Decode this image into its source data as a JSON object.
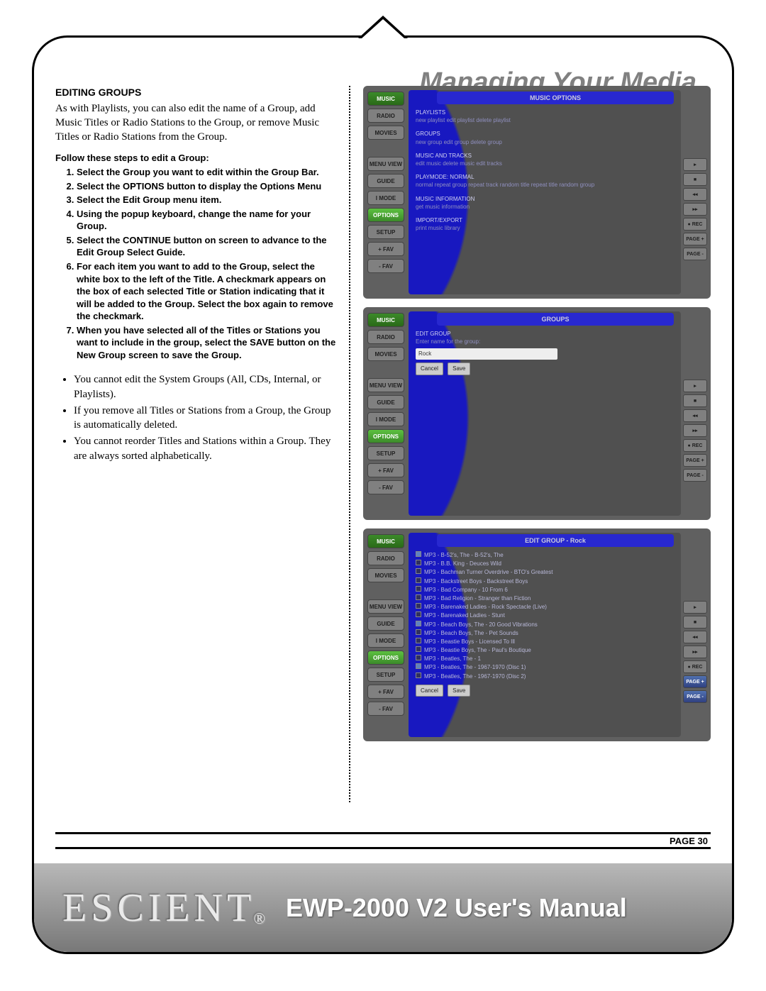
{
  "header": {
    "title": "Managing Your Media"
  },
  "section": {
    "heading": "EDITING GROUPS",
    "intro": "As with Playlists, you can also edit the name of a Group, add Music Titles or Radio Stations to the Group, or remove Music Titles or Radio Stations from the Group.",
    "steps_title": "Follow these steps to edit a Group:",
    "steps": [
      "Select the Group you want to edit within the Group Bar.",
      "Select the OPTIONS button to display the Options Menu",
      "Select the Edit Group menu item.",
      "Using the popup keyboard, change the name for your Group.",
      "Select the CONTINUE button on screen to advance to the Edit Group Select Guide.",
      "For each item you want to add to the Group, select the white box to the left of the Title. A checkmark appears on the box of each selected Title or Station indicating that it will be added to the Group. Select the box again to remove the checkmark.",
      "When you have selected all of the Titles or Stations you want to include in the group, select the SAVE button on the New Group screen to save the Group."
    ],
    "notes": [
      "You cannot edit the System Groups (All, CDs, Internal, or Playlists).",
      "If you remove all Titles or Stations from a Group, the Group is automatically deleted.",
      "You cannot reorder Titles and Stations within a Group. They are always sorted alphabetically."
    ]
  },
  "ui_sidebar": {
    "music": "MUSIC",
    "radio": "RADIO",
    "movies": "MOVIES",
    "menuview": "MENU VIEW",
    "guide": "GUIDE",
    "imode": "I MODE",
    "options": "OPTIONS",
    "setup": "SETUP",
    "addfav": "+ FAV",
    "subfav": "- FAV"
  },
  "ui_rightbar": {
    "tri": "▸",
    "stop": "■",
    "rew": "◂◂",
    "ffwd": "▸▸",
    "rec": "● REC",
    "pageup": "PAGE +",
    "pagedn": "PAGE -"
  },
  "shot1": {
    "title": "MUSIC OPTIONS",
    "g1h": "PLAYLISTS",
    "g1s": "new playlist   edit playlist   delete playlist",
    "g2h": "GROUPS",
    "g2s": "new group   edit group   delete group",
    "g3h": "MUSIC AND TRACKS",
    "g3s": "edit music   delete music   edit tracks",
    "g4h": "PLAYMODE: NORMAL",
    "g4s": "normal   repeat group   repeat track   random title   repeat title   random group",
    "g5h": "MUSIC INFORMATION",
    "g5s": "get music information",
    "g6h": "IMPORT/EXPORT",
    "g6s": "print music library"
  },
  "shot2": {
    "title": "GROUPS",
    "subtitle": "EDIT GROUP",
    "prompt": "Enter name for the group:",
    "input_value": "Rock",
    "btn_cancel": "Cancel",
    "btn_save": "Save"
  },
  "shot3": {
    "title": "EDIT GROUP - Rock",
    "items": [
      {
        "c": true,
        "t": "MP3 - B-52's, The - B-52's, The"
      },
      {
        "c": false,
        "t": "MP3 - B.B. King - Deuces Wild"
      },
      {
        "c": false,
        "t": "MP3 - Bachman Turner Overdrive - BTO's Greatest"
      },
      {
        "c": false,
        "t": "MP3 - Backstreet Boys - Backstreet Boys"
      },
      {
        "c": false,
        "t": "MP3 - Bad Company - 10 From 6"
      },
      {
        "c": false,
        "t": "MP3 - Bad Religion - Stranger than Fiction"
      },
      {
        "c": false,
        "t": "MP3 - Barenaked Ladies - Rock Spectacle (Live)"
      },
      {
        "c": false,
        "t": "MP3 - Barenaked Ladies - Stunt"
      },
      {
        "c": true,
        "t": "MP3 - Beach Boys, The - 20 Good Vibrations"
      },
      {
        "c": false,
        "t": "MP3 - Beach Boys, The - Pet Sounds"
      },
      {
        "c": false,
        "t": "MP3 - Beastie Boys - Licensed To Ill"
      },
      {
        "c": false,
        "t": "MP3 - Beastie Boys, The - Paul's Boutique"
      },
      {
        "c": false,
        "t": "MP3 - Beatles, The - 1"
      },
      {
        "c": true,
        "t": "MP3 - Beatles, The - 1967-1970 (Disc 1)"
      },
      {
        "c": false,
        "t": "MP3 - Beatles, The - 1967-1970 (Disc 2)"
      }
    ],
    "btn_cancel": "Cancel",
    "btn_save": "Save"
  },
  "footer": {
    "page": "PAGE 30",
    "brand": "ESCIENT",
    "reg": "®",
    "product": "EWP-2000 V2 User's Manual"
  }
}
